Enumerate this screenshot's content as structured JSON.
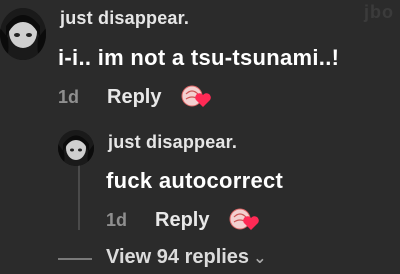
{
  "watermark": "jbo",
  "comment": {
    "username": "just disappear.",
    "text": "i-i.. im not a tsu-tsunami..!",
    "time": "1d",
    "reply_label": "Reply",
    "reaction_icon": "heart-reaction-icon"
  },
  "reply": {
    "username": "just disappear.",
    "text": "fuck autocorrect",
    "time": "1d",
    "reply_label": "Reply",
    "reaction_icon": "heart-reaction-icon"
  },
  "view_replies": {
    "label": "View 94 replies",
    "icon": "chevron-down-icon"
  },
  "colors": {
    "background": "#2b2b2b",
    "heart": "#ff2a55",
    "muted_text": "#8f8f8f"
  }
}
